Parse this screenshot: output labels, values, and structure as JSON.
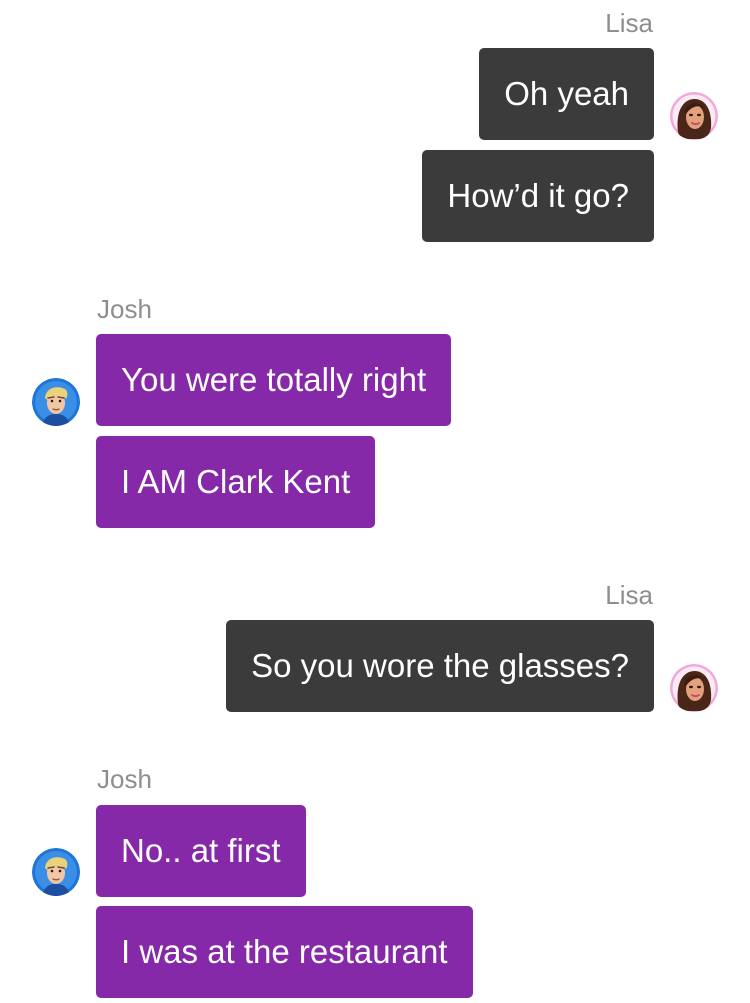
{
  "conversation": {
    "messages": [
      {
        "sender": "Lisa",
        "text": "Oh yeah"
      },
      {
        "sender": "Lisa",
        "text": "How’d it go?"
      },
      {
        "sender": "Josh",
        "text": "You were totally right"
      },
      {
        "sender": "Josh",
        "text": "I AM Clark Kent"
      },
      {
        "sender": "Lisa",
        "text": "So you wore the glasses?"
      },
      {
        "sender": "Josh",
        "text": "No.. at first"
      },
      {
        "sender": "Josh",
        "text": "I was at the restaurant"
      }
    ],
    "groups": [
      {
        "sender": "Lisa"
      },
      {
        "sender": "Josh"
      },
      {
        "sender": "Lisa"
      },
      {
        "sender": "Josh"
      }
    ]
  },
  "avatars": {
    "lisa": "woman-portrait-avatar",
    "josh": "man-portrait-avatar"
  },
  "colors": {
    "outgoing_bubble": "#3b3b3b",
    "incoming_bubble": "#8629a8",
    "sender_name": "#8e8e8e",
    "josh_avatar_ring": "#1f74d8",
    "lisa_avatar_ring": "#f2a8d8"
  }
}
